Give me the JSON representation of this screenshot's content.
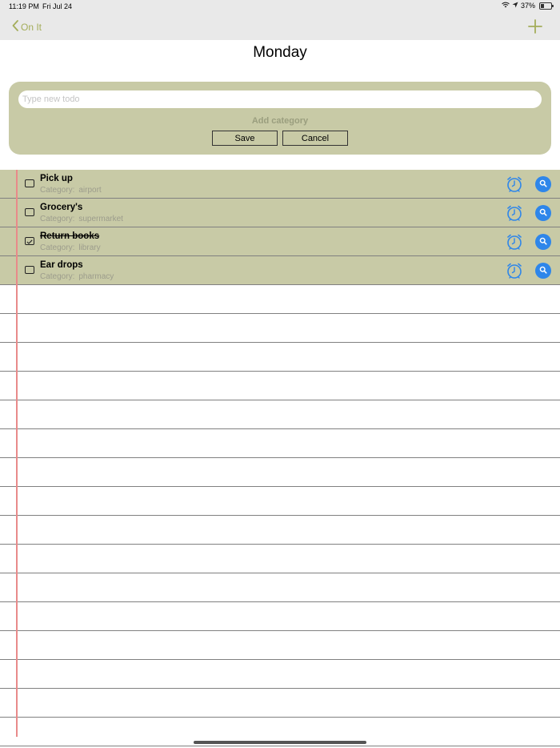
{
  "status": {
    "time": "11:19 PM",
    "date": "Fri Jul 24",
    "battery": "37%",
    "battery_level": 0.37
  },
  "nav": {
    "back_label": "On It"
  },
  "page": {
    "title": "Monday"
  },
  "new_todo": {
    "placeholder": "Type new todo",
    "add_category": "Add category",
    "save_label": "Save",
    "cancel_label": "Cancel"
  },
  "todos": [
    {
      "title": "Pick up",
      "category_label": "Category:",
      "category": "airport",
      "done": false
    },
    {
      "title": "Grocery's",
      "category_label": "Category:",
      "category": "supermarket",
      "done": false
    },
    {
      "title": "Return books",
      "category_label": "Category:",
      "category": "library",
      "done": true
    },
    {
      "title": "Ear drops",
      "category_label": "Category:",
      "category": "pharmacy",
      "done": false
    }
  ],
  "colors": {
    "accent": "#a4ad5a",
    "card": "#c8caa6",
    "action_blue": "#2e86ea",
    "margin_red": "#e88a8a"
  }
}
